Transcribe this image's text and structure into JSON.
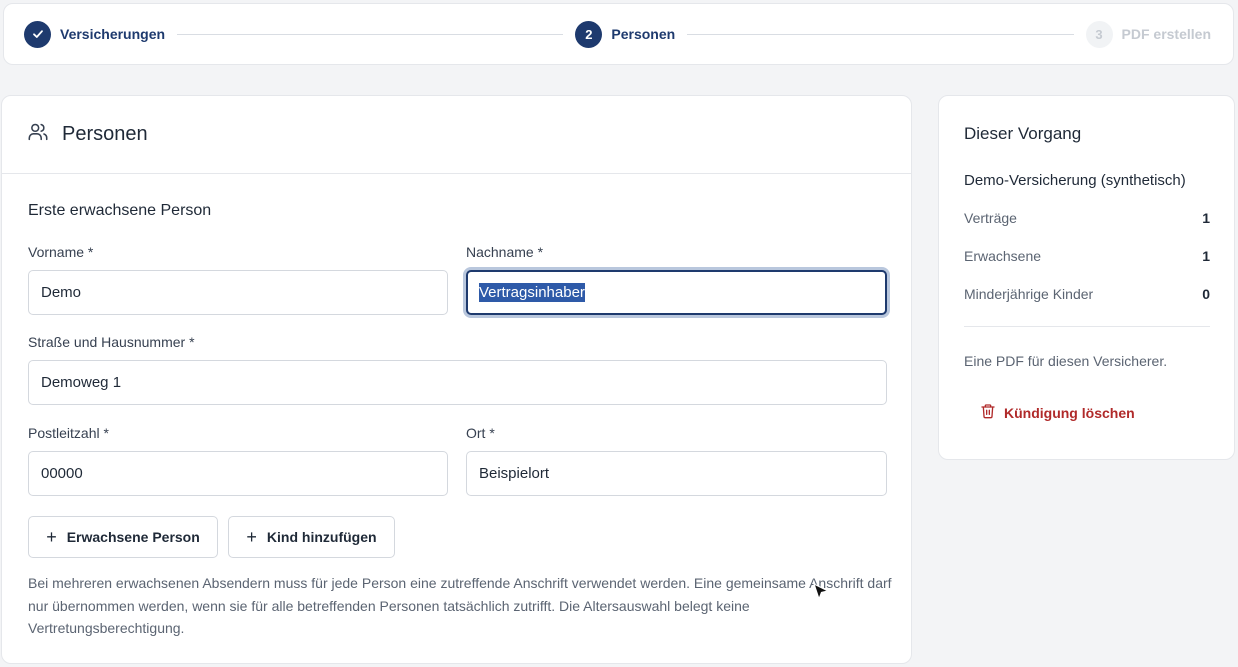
{
  "stepper": {
    "steps": [
      {
        "number": "1",
        "label": "Versicherungen",
        "state": "done"
      },
      {
        "number": "2",
        "label": "Personen",
        "state": "active"
      },
      {
        "number": "3",
        "label": "PDF erstellen",
        "state": "pending"
      }
    ]
  },
  "main": {
    "title": "Personen",
    "section_title": "Erste erwachsene Person",
    "fields": {
      "vorname": {
        "label": "Vorname *",
        "value": "Demo"
      },
      "nachname": {
        "label": "Nachname *",
        "value": "Vertragsinhaber"
      },
      "strasse": {
        "label": "Straße und Hausnummer *",
        "value": "Demoweg 1"
      },
      "plz": {
        "label": "Postleitzahl *",
        "value": "00000"
      },
      "ort": {
        "label": "Ort *",
        "value": "Beispielort"
      }
    },
    "buttons": {
      "add_adult": "Erwachsene Person",
      "add_child": "Kind hinzufügen"
    },
    "hint": "Bei mehreren erwachsenen Absendern muss für jede Person eine zutreffende Anschrift verwendet werden. Eine gemeinsame Anschrift darf nur übernommen werden, wenn sie für alle betreffenden Personen tatsächlich zutrifft. Die Altersauswahl belegt keine Vertretungsberechtigung."
  },
  "sidebar": {
    "title": "Dieser Vorgang",
    "insurer": "Demo-Versicherung (synthetisch)",
    "stats": [
      {
        "label": "Verträge",
        "value": "1"
      },
      {
        "label": "Erwachsene",
        "value": "1"
      },
      {
        "label": "Minderjährige Kinder",
        "value": "0"
      }
    ],
    "note": "Eine PDF für diesen Versicherer.",
    "delete_label": "Kündigung löschen"
  },
  "colors": {
    "accent": "#1e3a6e",
    "danger": "#b02a2a",
    "selection": "#2e5aa8"
  }
}
